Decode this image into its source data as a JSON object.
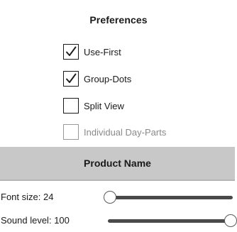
{
  "title": "Preferences",
  "options": [
    {
      "label": "Use-First",
      "checked": true,
      "disabled": false
    },
    {
      "label": "Group-Dots",
      "checked": true,
      "disabled": false
    },
    {
      "label": "Split View",
      "checked": false,
      "disabled": false
    },
    {
      "label": "Individual Day-Parts",
      "checked": false,
      "disabled": true
    }
  ],
  "product_name_label": "Product Name",
  "font_size": {
    "label": "Font size:",
    "value": "24",
    "fraction": 0.0
  },
  "sound_level": {
    "label": "Sound level:",
    "value": "100",
    "fraction": 1.0
  },
  "colors": {
    "product_bar": "#c8c8c8",
    "track": "#4a4a4a",
    "disabled_text": "#8a8a8a"
  },
  "icons": {
    "check": "check-icon"
  }
}
